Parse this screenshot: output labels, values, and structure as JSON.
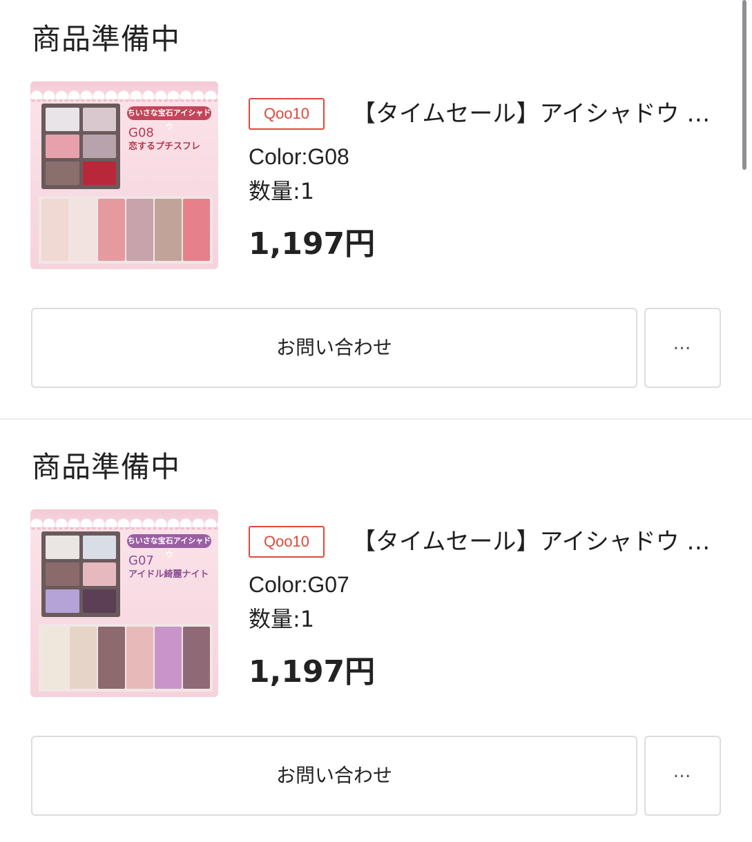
{
  "orders": [
    {
      "status": "商品準備中",
      "thumbnail": {
        "tag": "ちいさな宝石アイシャドウ",
        "shade_code": "G08",
        "shade_name": "恋するプチスフレ",
        "tag_color": "#c2455a",
        "text_color": "#b23a4e",
        "pans": [
          "#e8e4e8",
          "#d9c9cf",
          "#e6a1ad",
          "#b8a3ad",
          "#8a6f6c",
          "#b8283a"
        ],
        "swatches": [
          "#f0d9d2",
          "#f2e2e0",
          "#e59aa0",
          "#c9a3ab",
          "#c2a39a",
          "#e6808a"
        ]
      },
      "store_badge": "Qoo10",
      "product_title": "【タイムセール】アイシャドウ …",
      "color_text": "Color:G08",
      "quantity_text": "数量:1",
      "price": "1,197円",
      "inquiry_label": "お問い合わせ",
      "more_label": "…"
    },
    {
      "status": "商品準備中",
      "thumbnail": {
        "tag": "ちいさな宝石アイシャドウ",
        "shade_code": "G07",
        "shade_name": "アイドル綺麗ナイト",
        "tag_color": "#9a5fa3",
        "text_color": "#8a4e94",
        "pans": [
          "#eae6e4",
          "#d9dde6",
          "#8a6a6a",
          "#e6b9bf",
          "#b5a2d6",
          "#5c3f54"
        ],
        "swatches": [
          "#efe7dc",
          "#e6d4c8",
          "#8d6a6e",
          "#e8b9b9",
          "#c894c9",
          "#8f6a76"
        ]
      },
      "store_badge": "Qoo10",
      "product_title": "【タイムセール】アイシャドウ …",
      "color_text": "Color:G07",
      "quantity_text": "数量:1",
      "price": "1,197円",
      "inquiry_label": "お問い合わせ",
      "more_label": "…"
    }
  ]
}
